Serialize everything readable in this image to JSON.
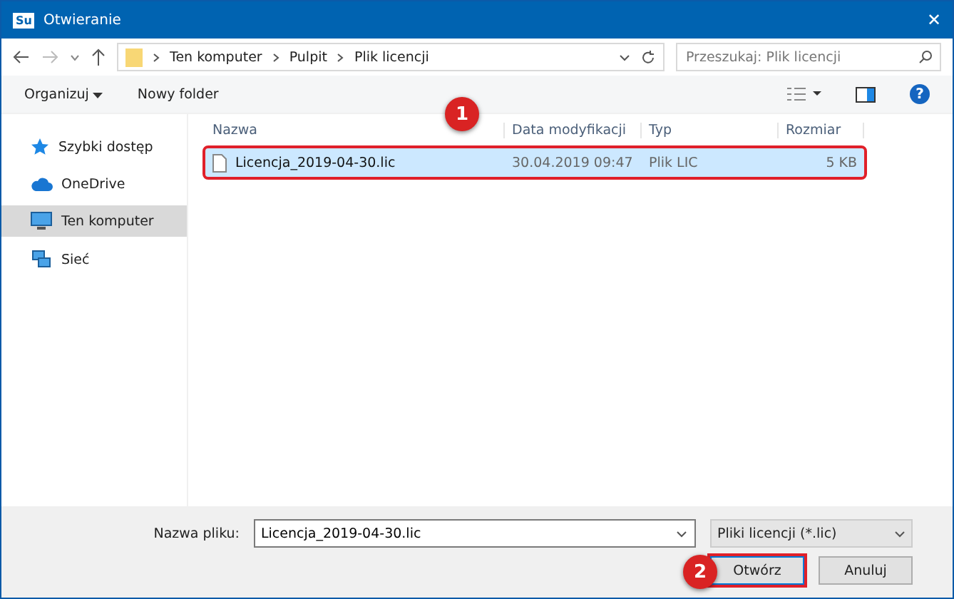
{
  "window": {
    "app_badge": "Su",
    "title": "Otwieranie",
    "close": "✕"
  },
  "address_bar": {
    "path": [
      "Ten komputer",
      "Pulpit",
      "Plik licencji"
    ],
    "search_placeholder": "Przeszukaj: Plik licencji"
  },
  "toolbar": {
    "organize": "Organizuj",
    "new_folder": "Nowy folder",
    "help": "?"
  },
  "sidebar": {
    "items": [
      {
        "label": "Szybki dostęp",
        "kind": "star",
        "selected": false
      },
      {
        "label": "OneDrive",
        "kind": "cloud",
        "selected": false
      },
      {
        "label": "Ten komputer",
        "kind": "computer",
        "selected": true
      },
      {
        "label": "Sieć",
        "kind": "network",
        "selected": false
      }
    ]
  },
  "file_list": {
    "columns": [
      "Nazwa",
      "Data modyfikacji",
      "Typ",
      "Rozmiar"
    ],
    "rows": [
      {
        "name": "Licencja_2019-04-30.lic",
        "modified": "30.04.2019 09:47",
        "type": "Plik LIC",
        "size": "5 KB",
        "selected": true
      }
    ]
  },
  "footer": {
    "filename_label": "Nazwa pliku:",
    "filename": "Licencja_2019-04-30.lic",
    "filter": "Pliki licencji (*.lic)",
    "open": "Otwórz",
    "cancel": "Anuluj"
  },
  "callouts": [
    "1",
    "2"
  ]
}
